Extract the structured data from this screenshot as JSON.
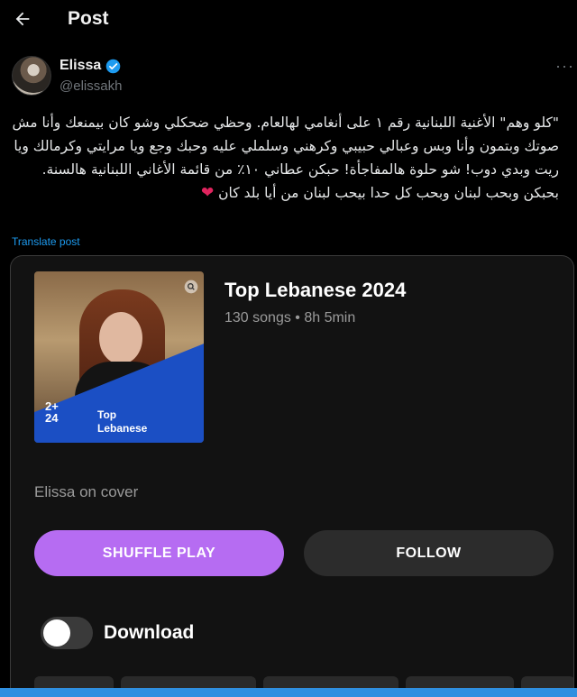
{
  "header": {
    "title": "Post",
    "back_icon": "arrow-left-icon"
  },
  "author": {
    "name": "Elissa",
    "handle": "@elissakh",
    "verified": true,
    "verified_color": "#1d9bf0"
  },
  "post": {
    "text": "\"كلو وهم\" الأغنية اللبنانية رقم ١ على أنغامي لهالعام. وحظي ضحكلي وشو كان بيمنعك وأنا مش صوتك وبتمون وأنا وبس وعبالي حبيبي وكرهني وسلملي عليه وحبك وجع ويا مرايتي وكرمالك ويا ريت وبدي دوب! شو حلوة هالمفاجأة! حبكن عطاني ١٠٪ من قائمة الأغاني اللبنانية هالسنة. بحبكن وبحب لبنان وبحب كل حدا بيحب لبنان من أيا بلد كان",
    "heart_emoji": "❤",
    "translate_label": "Translate post"
  },
  "card": {
    "cover": {
      "badge_number": "2+\n24",
      "badge_label": "Top\nLebanese"
    },
    "playlist_title": "Top Lebanese 2024",
    "meta": "130 songs • 8h 5min",
    "caption": "Elissa on cover",
    "shuffle_label": "SHUFFLE PLAY",
    "follow_label": "FOLLOW",
    "download_label": "Download",
    "download_enabled": false,
    "accent_color": "#b66cf2"
  }
}
